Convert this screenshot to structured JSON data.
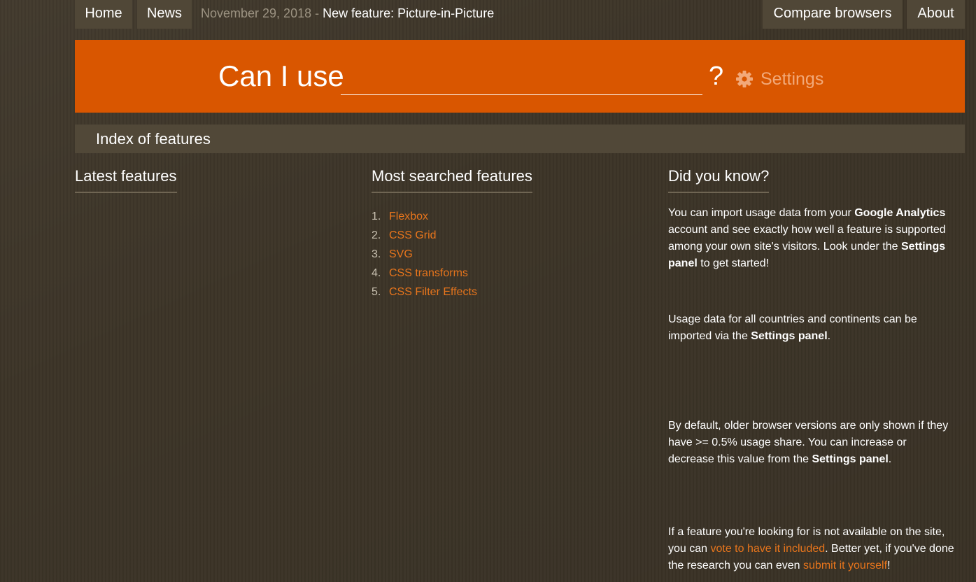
{
  "nav": {
    "home": "Home",
    "news": "News",
    "compare": "Compare browsers",
    "about": "About"
  },
  "news_ticker": {
    "date": "November 29, 2018",
    "separator": " - ",
    "headline": "New feature: Picture-in-Picture"
  },
  "search": {
    "label": "Can I use",
    "value": "",
    "question_mark": "?",
    "settings_label": "Settings",
    "settings_icon": "gear-icon"
  },
  "index_bar": {
    "label": "Index of features"
  },
  "latest": {
    "heading": "Latest features"
  },
  "most_searched": {
    "heading": "Most searched features",
    "items": [
      {
        "num": "1.",
        "label": "Flexbox"
      },
      {
        "num": "2.",
        "label": "CSS Grid"
      },
      {
        "num": "3.",
        "label": "SVG"
      },
      {
        "num": "4.",
        "label": "CSS transforms"
      },
      {
        "num": "5.",
        "label": "CSS Filter Effects"
      }
    ]
  },
  "did_you_know": {
    "heading": "Did you know?",
    "p1": {
      "t1": "You can import usage data from your ",
      "b1": "Google Analytics",
      "t2": " account and see exactly how well a feature is supported among your own site's visitors. Look under the ",
      "b2": "Settings panel",
      "t3": " to get started!"
    },
    "p2": {
      "t1": "Usage data for all countries and continents can be imported via the ",
      "b1": "Settings panel",
      "t2": "."
    },
    "p3": {
      "t1": "By default, older browser versions are only shown if they have >= 0.5% usage share. You can increase or decrease this value from the ",
      "b1": "Settings panel",
      "t2": "."
    },
    "p4": {
      "t1": "If a feature you're looking for is not available on the site, you can ",
      "link1": "vote to have it included",
      "t2": ". Better yet, if you've done the research you can even ",
      "link2": "submit it yourself",
      "t3": "!"
    }
  },
  "colors": {
    "background": "#3d3528",
    "banner": "#d95600",
    "nav_button": "#504737",
    "link": "#e8751c",
    "settings_text": "#f2a979"
  }
}
